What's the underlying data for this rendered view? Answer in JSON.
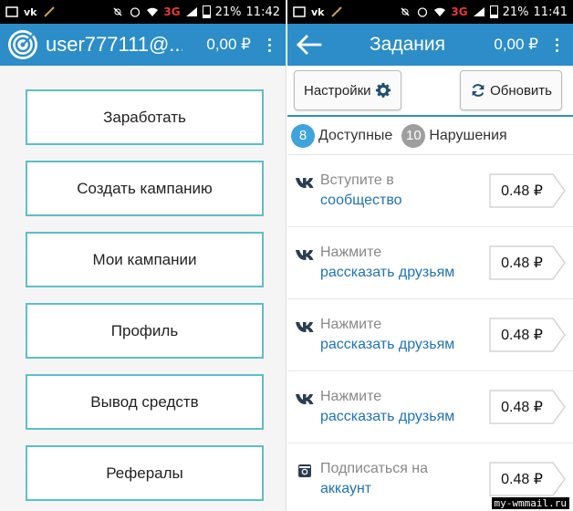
{
  "left": {
    "status": {
      "battery": "21%",
      "time": "11:42",
      "network": "3G"
    },
    "appbar": {
      "title": "user777111@...",
      "balance": "0,00 ₽"
    },
    "menu": [
      {
        "label": "Заработать",
        "name": "earn-button"
      },
      {
        "label": "Создать кампанию",
        "name": "create-campaign-button"
      },
      {
        "label": "Мои кампании",
        "name": "my-campaigns-button"
      },
      {
        "label": "Профиль",
        "name": "profile-button"
      },
      {
        "label": "Вывод средств",
        "name": "withdraw-button"
      },
      {
        "label": "Рефералы",
        "name": "referrals-button"
      }
    ]
  },
  "right": {
    "status": {
      "battery": "21%",
      "time": "11:41",
      "network": "3G"
    },
    "appbar": {
      "title": "Задания",
      "balance": "0,00 ₽"
    },
    "toolbar": {
      "settings_label": "Настройки",
      "refresh_label": "Обновить"
    },
    "tabs": [
      {
        "count": "8",
        "label": "Доступные"
      },
      {
        "count": "10",
        "label": "Нарушения"
      }
    ],
    "tasks": [
      {
        "icon": "vk-icon",
        "action": "Вступите в",
        "target": "сообщество",
        "price": "0.48 ₽"
      },
      {
        "icon": "vk-icon",
        "action": "Нажмите",
        "target": "рассказать друзьям",
        "price": "0.48 ₽"
      },
      {
        "icon": "vk-icon",
        "action": "Нажмите",
        "target": "рассказать друзьям",
        "price": "0.48 ₽"
      },
      {
        "icon": "vk-icon",
        "action": "Нажмите",
        "target": "рассказать друзьям",
        "price": "0.48 ₽"
      },
      {
        "icon": "instagram-icon",
        "action": "Подписаться на",
        "target": "аккаунт",
        "price": "0.48 ₽"
      }
    ]
  },
  "watermark": "my-wmmail.ru",
  "colors": {
    "primary": "#2c8dc8",
    "button_border": "#5cbfc7",
    "link": "#2073b5",
    "badge_blue": "#3fa4db",
    "badge_gray": "#9e9e9e",
    "network_red": "#e53935"
  }
}
